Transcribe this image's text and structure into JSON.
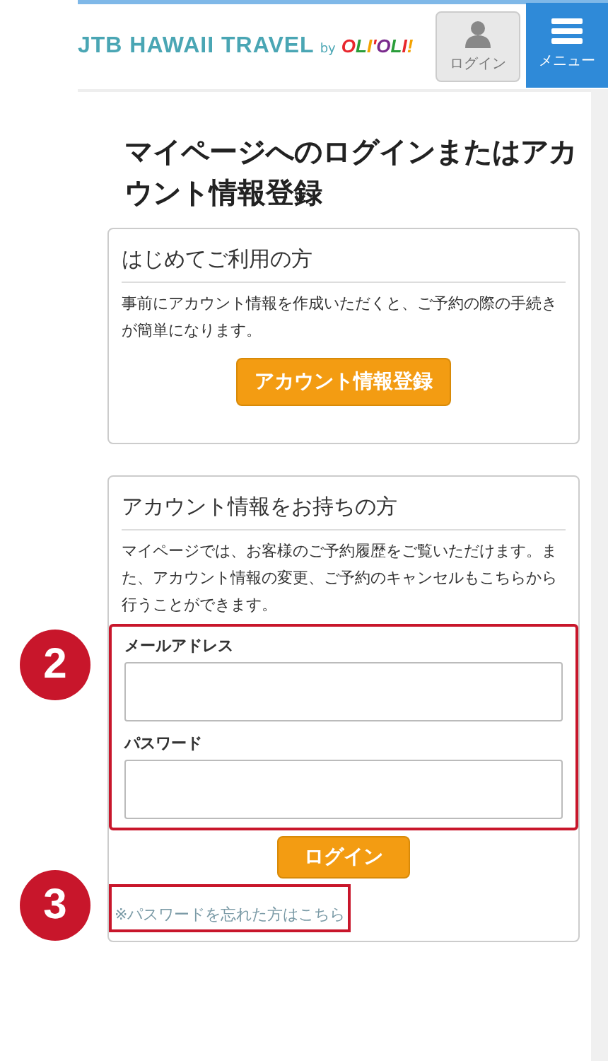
{
  "header": {
    "logo": "JTB HAWAII TRAVEL",
    "logo_by": "by",
    "logo_brand": "OLI'OLI!",
    "login_button": "ログイン",
    "menu_button": "メニュー"
  },
  "title": "マイページへのログインまたはアカウント情報登録",
  "new_user": {
    "heading": "はじめてご利用の方",
    "text": "事前にアカウント情報を作成いただくと、ご予約の際の手続きが簡単になります。",
    "button": "アカウント情報登録"
  },
  "existing_user": {
    "heading": "アカウント情報をお持ちの方",
    "text": "マイページでは、お客様のご予約履歴をご覧いただけます。また、アカウント情報の変更、ご予約のキャンセルもこちらから行うことができます。",
    "fields": [
      {
        "label": "メールアドレス"
      },
      {
        "label": "パスワード"
      }
    ],
    "button": "ログイン",
    "forgot_link": "※パスワードを忘れた方はこちら"
  },
  "annotations": [
    {
      "number": "2"
    },
    {
      "number": "3"
    }
  ]
}
